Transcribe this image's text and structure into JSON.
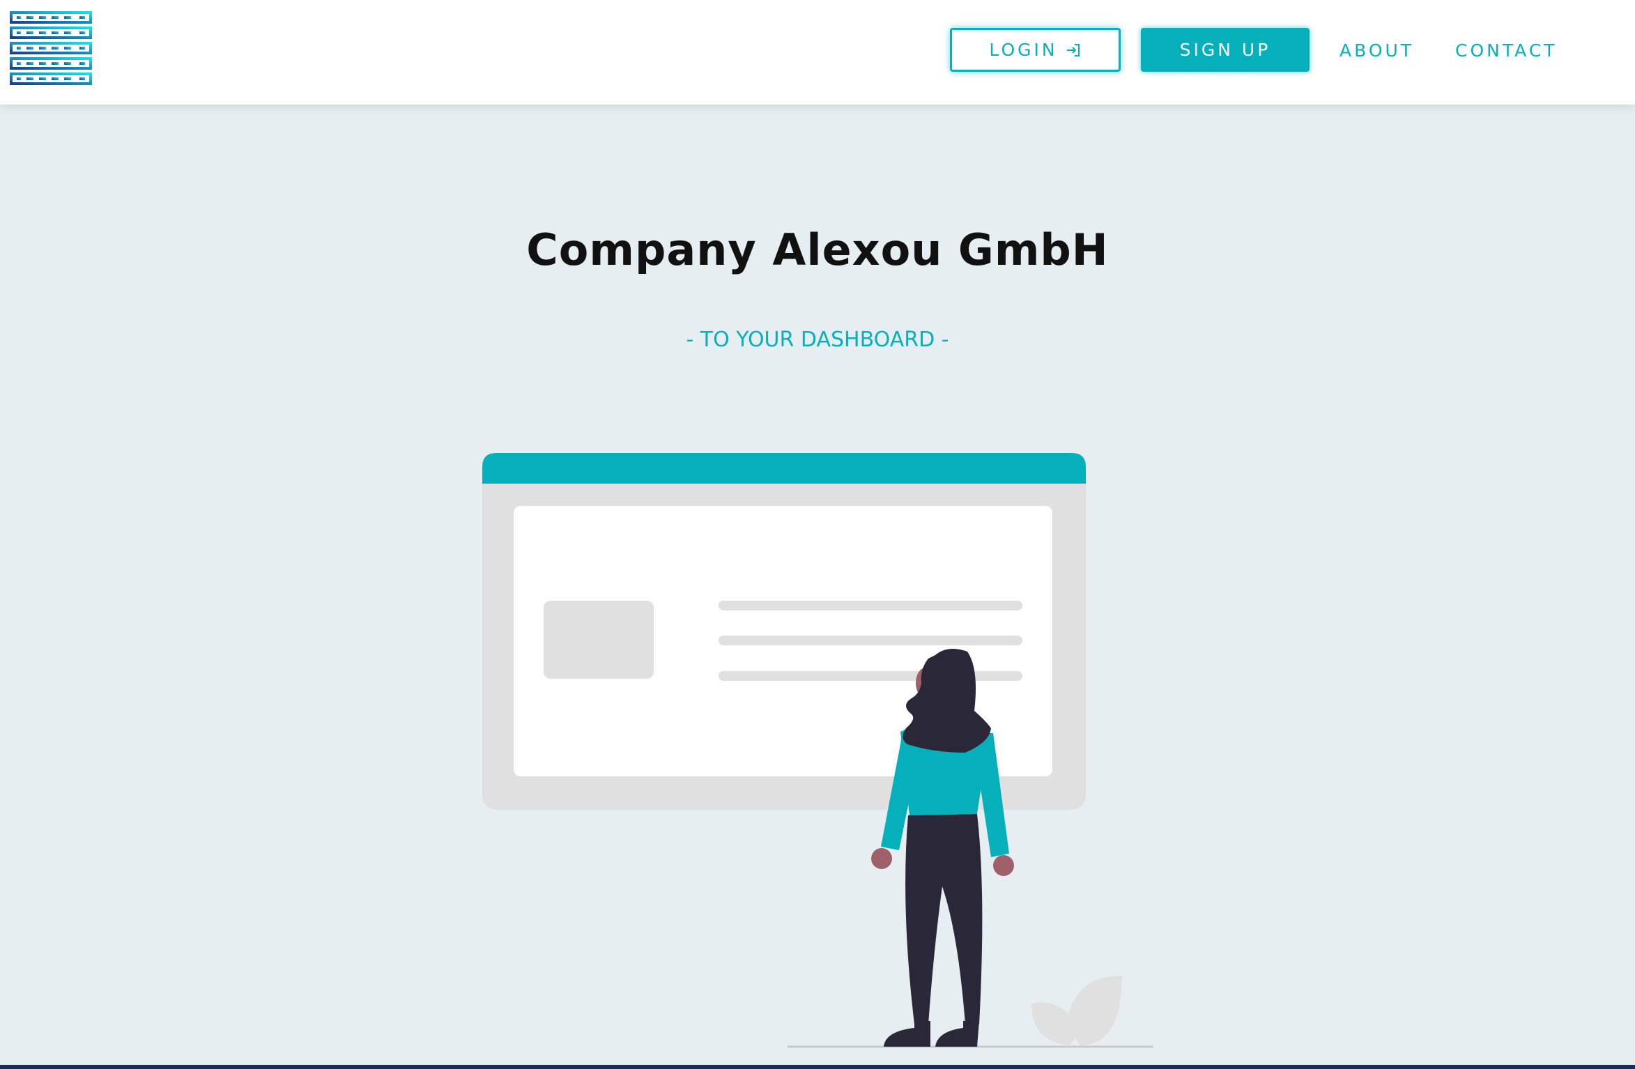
{
  "navbar": {
    "logo_icon": "server-stack-icon",
    "login_label": "LOGIN",
    "login_icon": "sign-in-icon",
    "signup_label": "SIGN UP",
    "about_label": "ABOUT",
    "contact_label": "CONTACT"
  },
  "hero": {
    "title": "Company Alexou GmbH",
    "subtitle": "- TO YOUR DASHBOARD -"
  },
  "colors": {
    "accent": "#05b0bb",
    "background": "#e7eef1",
    "navbar": "#ffffff",
    "text": "#111111"
  }
}
